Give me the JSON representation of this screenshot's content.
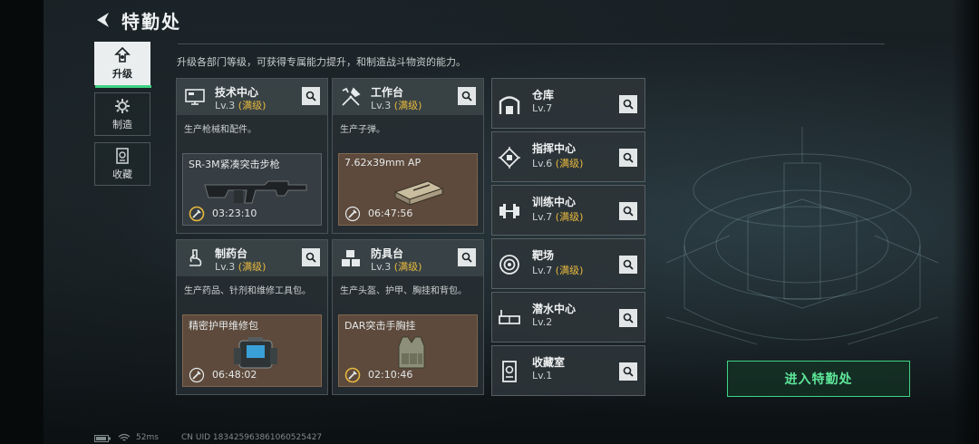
{
  "header": {
    "title": "特勤处",
    "subtitle": "升级各部门等级，可获得专属能力提升，和制造战斗物资的能力。"
  },
  "nav": [
    {
      "label": "升级",
      "icon": "upgrade-icon",
      "active": true
    },
    {
      "label": "制造",
      "icon": "gear-icon",
      "active": false
    },
    {
      "label": "收藏",
      "icon": "collection-icon",
      "active": false
    }
  ],
  "cards": [
    {
      "name": "技术中心",
      "level": "Lv.3",
      "max": "(满级)",
      "icon": "monitor-icon",
      "desc": "生产枪械和配件。",
      "product": {
        "name": "SR-3M紧凑突击步枪",
        "time": "03:23:10",
        "icon": "rifle-icon"
      }
    },
    {
      "name": "工作台",
      "level": "Lv.3",
      "max": "(满级)",
      "icon": "tools-icon",
      "desc": "生产子弹。",
      "product": {
        "name": "7.62x39mm AP",
        "time": "06:47:56",
        "icon": "ammo-box-icon"
      }
    },
    {
      "name": "制药台",
      "level": "Lv.3",
      "max": "(满级)",
      "icon": "microscope-icon",
      "desc": "生产药品、针剂和维修工具包。",
      "product": {
        "name": "精密护甲维修包",
        "time": "06:48:02",
        "icon": "repair-kit-icon"
      }
    },
    {
      "name": "防具台",
      "level": "Lv.3",
      "max": "(满级)",
      "icon": "armor-cubes-icon",
      "desc": "生产头盔、护甲、胸挂和背包。",
      "product": {
        "name": "DAR突击手胸挂",
        "time": "02:10:46",
        "icon": "chest-rig-icon"
      }
    }
  ],
  "list": [
    {
      "name": "仓库",
      "level": "Lv.7",
      "max": "",
      "icon": "warehouse-icon"
    },
    {
      "name": "指挥中心",
      "level": "Lv.6",
      "max": "(满级)",
      "icon": "chip-icon"
    },
    {
      "name": "训练中心",
      "level": "Lv.7",
      "max": "(满级)",
      "icon": "dumbbell-icon"
    },
    {
      "name": "靶场",
      "level": "Lv.7",
      "max": "(满级)",
      "icon": "target-icon"
    },
    {
      "name": "潜水中心",
      "level": "Lv.2",
      "max": "",
      "icon": "diving-mask-icon"
    },
    {
      "name": "收藏室",
      "level": "Lv.1",
      "max": "",
      "icon": "trophy-icon"
    }
  ],
  "enter_button": "进入特勤处",
  "status": {
    "ping": "52ms",
    "uid": "CN UID 1834259638610605254​27"
  },
  "colors": {
    "accent": "#3fd383",
    "max_level": "#e8b93d",
    "product_brown": "#5d4a3c"
  }
}
